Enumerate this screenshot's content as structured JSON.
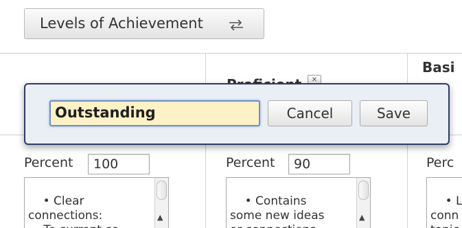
{
  "top_button": {
    "label": "Levels of Achievement",
    "icon": "swap-arrows-icon"
  },
  "columns": [
    {
      "header": "",
      "percent_label": "Percent",
      "percent_value": "100",
      "description": "• Clear\nconnections:\n  - To current co"
    },
    {
      "header": "Proficient",
      "percent_label": "Percent",
      "percent_value": "90",
      "description": "• Contains\nsome new ideas\nor connections"
    },
    {
      "header": "Basi",
      "percent_label": "Perc",
      "percent_value": "",
      "description": "• Lin\nconn\ntopic"
    }
  ],
  "header_dropdown_icon": "chevron-down-icon",
  "editor": {
    "name_value": "Outstanding",
    "cancel_label": "Cancel",
    "save_label": "Save"
  },
  "colors": {
    "editor_border": "#2c3c64",
    "input_focus_bg": "#fdf1c6"
  }
}
